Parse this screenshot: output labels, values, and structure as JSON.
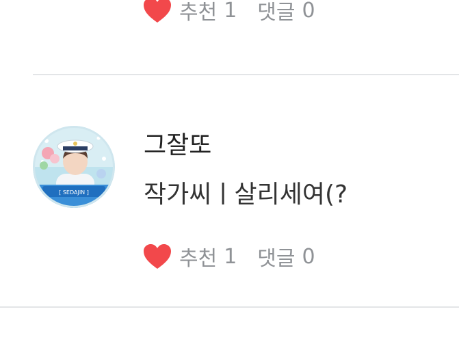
{
  "previous_comment": {
    "like_label": "추천",
    "like_count": "1",
    "reply_label": "댓글",
    "reply_count": "0"
  },
  "comment": {
    "author": "그잘또",
    "text": "작가씨ㅣ살리세여(?",
    "avatar_caption": "[ SEDAJIN ]",
    "like_label": "추천",
    "like_count": "1",
    "reply_label": "댓글",
    "reply_count": "0"
  },
  "colors": {
    "heart": "#f2484b",
    "meta_text": "#8f9296",
    "divider": "#e3e5e7"
  }
}
